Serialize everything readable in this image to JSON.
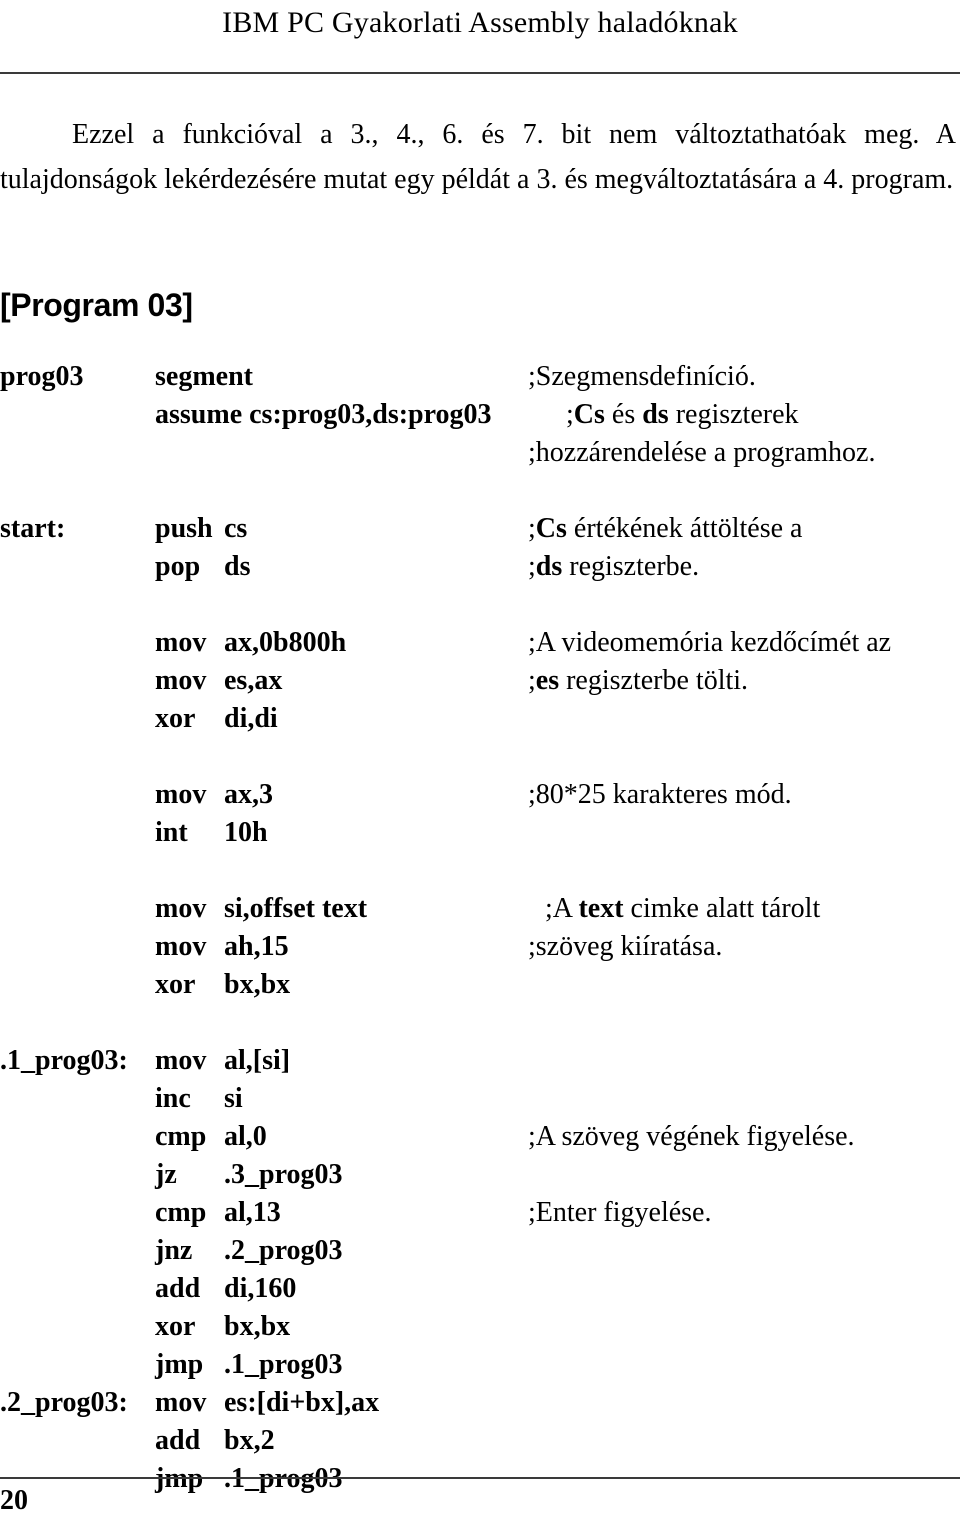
{
  "page": {
    "running_head": "IBM PC Gyakorlati Assembly haladóknak",
    "folio": "20"
  },
  "intro": {
    "paragraph": "Ezzel a funkcióval a 3., 4., 6. és 7. bit nem változtathatóak meg. A tulajdonságok lekérdezésére mutat egy példát a 3. és megváltoztatására a 4. program."
  },
  "section": {
    "heading": "[Program 03]"
  },
  "listing": {
    "lines": [
      {
        "label": "prog03",
        "mnemonic": "segment",
        "operand": "",
        "comment_prefix": ";Szegmensdefiníció.",
        "comment_bold": "",
        "comment_suffix": ""
      },
      {
        "label": "",
        "mnemonic": "assume cs:prog03,ds:prog03",
        "operand": "",
        "comment_prefix": ";",
        "comment_bold": "Cs",
        "comment_suffix": " és "
      },
      {
        "label": "",
        "mnemonic": "",
        "operand": "",
        "comment_prefix": ";hozzárendelése a programhoz.",
        "comment_bold": "",
        "comment_suffix": ""
      },
      {
        "label": "start:",
        "mnemonic": "push",
        "operand": "cs",
        "comment_prefix": ";",
        "comment_bold": "Cs",
        "comment_suffix": " értékének áttöltése a"
      },
      {
        "label": "",
        "mnemonic": "pop",
        "operand": "ds",
        "comment_prefix": ";",
        "comment_bold": "ds",
        "comment_suffix": " regiszterbe."
      },
      {
        "label": "",
        "mnemonic": "mov",
        "operand": "ax,0b800h",
        "comment_prefix": ";A videomemória kezdőcímét az",
        "comment_bold": "",
        "comment_suffix": ""
      },
      {
        "label": "",
        "mnemonic": "mov",
        "operand": "es,ax",
        "comment_prefix": ";",
        "comment_bold": "es",
        "comment_suffix": " regiszterbe tölti."
      },
      {
        "label": "",
        "mnemonic": "xor",
        "operand": "di,di",
        "comment_prefix": "",
        "comment_bold": "",
        "comment_suffix": ""
      },
      {
        "label": "",
        "mnemonic": "mov",
        "operand": "ax,3",
        "comment_prefix": ";80*25 karakteres mód.",
        "comment_bold": "",
        "comment_suffix": ""
      },
      {
        "label": "",
        "mnemonic": "int",
        "operand": "10h",
        "comment_prefix": "",
        "comment_bold": "",
        "comment_suffix": ""
      },
      {
        "label": "",
        "mnemonic": "mov",
        "operand": "si,offset text",
        "comment_prefix": ";A ",
        "comment_bold": "text",
        "comment_suffix": " cimke alatt tárolt"
      },
      {
        "label": "",
        "mnemonic": "mov",
        "operand": "ah,15",
        "comment_prefix": ";szöveg kiíratása.",
        "comment_bold": "",
        "comment_suffix": ""
      },
      {
        "label": "",
        "mnemonic": "xor",
        "operand": "bx,bx",
        "comment_prefix": "",
        "comment_bold": "",
        "comment_suffix": ""
      },
      {
        "label": ".1_prog03:",
        "mnemonic": "mov",
        "operand": "al,[si]",
        "comment_prefix": "",
        "comment_bold": "",
        "comment_suffix": ""
      },
      {
        "label": "",
        "mnemonic": "inc",
        "operand": "si",
        "comment_prefix": "",
        "comment_bold": "",
        "comment_suffix": ""
      },
      {
        "label": "",
        "mnemonic": "cmp",
        "operand": "al,0",
        "comment_prefix": ";A szöveg végének figyelése.",
        "comment_bold": "",
        "comment_suffix": ""
      },
      {
        "label": "",
        "mnemonic": "jz",
        "operand": ".3_prog03",
        "comment_prefix": "",
        "comment_bold": "",
        "comment_suffix": ""
      },
      {
        "label": "",
        "mnemonic": "cmp",
        "operand": "al,13",
        "comment_prefix": ";Enter figyelése.",
        "comment_bold": "",
        "comment_suffix": ""
      },
      {
        "label": "",
        "mnemonic": "jnz",
        "operand": ".2_prog03",
        "comment_prefix": "",
        "comment_bold": "",
        "comment_suffix": ""
      },
      {
        "label": "",
        "mnemonic": "add",
        "operand": "di,160",
        "comment_prefix": "",
        "comment_bold": "",
        "comment_suffix": ""
      },
      {
        "label": "",
        "mnemonic": "xor",
        "operand": "bx,bx",
        "comment_prefix": "",
        "comment_bold": "",
        "comment_suffix": ""
      },
      {
        "label": "",
        "mnemonic": "jmp",
        "operand": ".1_prog03",
        "comment_prefix": "",
        "comment_bold": "",
        "comment_suffix": ""
      },
      {
        "label": ".2_prog03:",
        "mnemonic": "mov",
        "operand": "es:[di+bx],ax",
        "comment_prefix": "",
        "comment_bold": "",
        "comment_suffix": ""
      },
      {
        "label": "",
        "mnemonic": "add",
        "operand": "bx,2",
        "comment_prefix": "",
        "comment_bold": "",
        "comment_suffix": ""
      },
      {
        "label": "",
        "mnemonic": "jmp",
        "operand": ".1_prog03",
        "comment_prefix": "",
        "comment_bold": "",
        "comment_suffix": ""
      }
    ],
    "comment_extra_assume": "regiszterek"
  }
}
